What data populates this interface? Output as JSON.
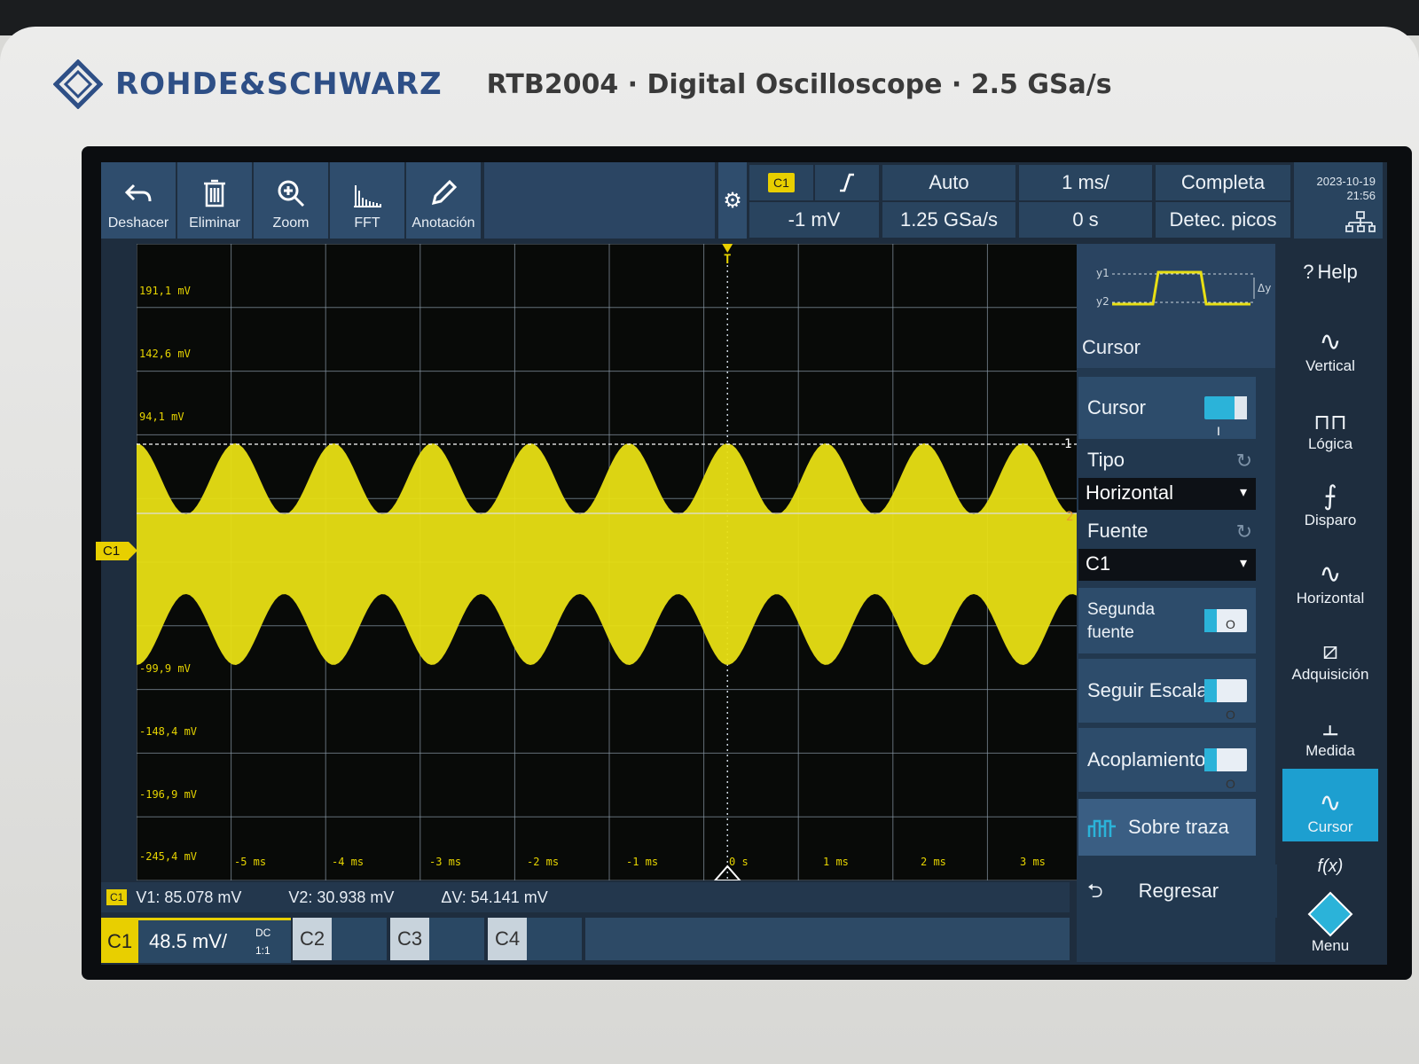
{
  "device": {
    "brand": "ROHDE&SCHWARZ",
    "model_line": "RTB2004 · Digital Oscilloscope · 2.5 GSa/s"
  },
  "toolbar": {
    "buttons": [
      {
        "label": "Deshacer",
        "icon": "undo-icon"
      },
      {
        "label": "Eliminar",
        "icon": "trash-icon"
      },
      {
        "label": "Zoom",
        "icon": "zoom-icon"
      },
      {
        "label": "FFT",
        "icon": "fft-icon"
      },
      {
        "label": "Anotación",
        "icon": "pencil-icon"
      }
    ]
  },
  "header": {
    "trigger_source": "C1",
    "trigger_level": "-1 mV",
    "trigger_mode": "Auto",
    "sample_rate": "1.25 GSa/s",
    "timebase": "1 ms/",
    "time_offset": "0 s",
    "acquisition": "Completa",
    "acq_mode": "Detec. picos",
    "date": "2023-10-19",
    "time": "21:56"
  },
  "plot": {
    "y_labels": [
      "191,1 mV",
      "142,6 mV",
      "94,1 mV",
      "-99,9 mV",
      "-148,4 mV",
      "-196,9 mV",
      "-245,4 mV"
    ],
    "x_labels": [
      "-5 ms",
      "-4 ms",
      "-3 ms",
      "-2 ms",
      "-1 ms",
      "0 s",
      "1 ms",
      "2 ms",
      "3 ms"
    ],
    "channel_marker": "C1",
    "cursor1_label": "1",
    "cursor2_label": "2",
    "trigger_marker": "T",
    "trace_color": "#e8df14",
    "grid_color": "#8a9aa8"
  },
  "status": {
    "tag": "C1",
    "v1": "V1: 85.078 mV",
    "v2": "V2: 30.938 mV",
    "dv": "ΔV: 54.141 mV"
  },
  "channels": {
    "c1_label": "C1",
    "c1_scale": "48.5 mV/",
    "c1_coupling": "DC",
    "c1_probe": "1:1",
    "c2_label": "C2",
    "c3_label": "C3",
    "c4_label": "C4"
  },
  "cursor_panel": {
    "preview_title": "Cursor",
    "preview_y1": "y1",
    "preview_y2": "y2",
    "preview_dy": "Δy",
    "cursor_label": "Cursor",
    "cursor_toggle": "I",
    "type_label": "Tipo",
    "type_value": "Horizontal",
    "source_label": "Fuente",
    "source_value": "C1",
    "second_source_label_1": "Segunda",
    "second_source_label_2": "fuente",
    "follow_scale_label": "Seguir Escala",
    "coupling_label": "Acoplamiento",
    "toggle_off_text": "O",
    "on_trace_label": "Sobre traza",
    "back_label": "Regresar"
  },
  "side_menu": {
    "help": "Help",
    "help_mark": "?",
    "items": [
      "Vertical",
      "Lógica",
      "Disparo",
      "Horizontal",
      "Adquisición",
      "Medida",
      "Cursor"
    ],
    "fx": "f(x)",
    "menu": "Menu"
  }
}
